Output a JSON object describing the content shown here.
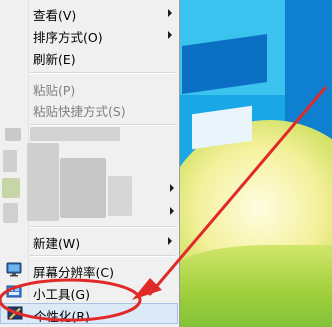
{
  "context_menu": {
    "view": "查看(V)",
    "sort_by": "排序方式(O)",
    "refresh": "刷新(E)",
    "paste": "粘贴(P)",
    "paste_shortcut": "粘贴快捷方式(S)",
    "new": "新建(W)",
    "screen_resolution": "屏幕分辨率(C)",
    "gadgets": "小工具(G)",
    "personalize": "个性化(R)"
  },
  "colors": {
    "annotation_red": "#e02a2a",
    "menu_highlight": "#dce9f7",
    "desktop_blue": "#1aa7e6"
  },
  "icons": {
    "screen_resolution": "monitor-icon",
    "gadgets": "gadgets-icon",
    "personalize": "personalize-icon",
    "submenu": "submenu-arrow-icon"
  }
}
